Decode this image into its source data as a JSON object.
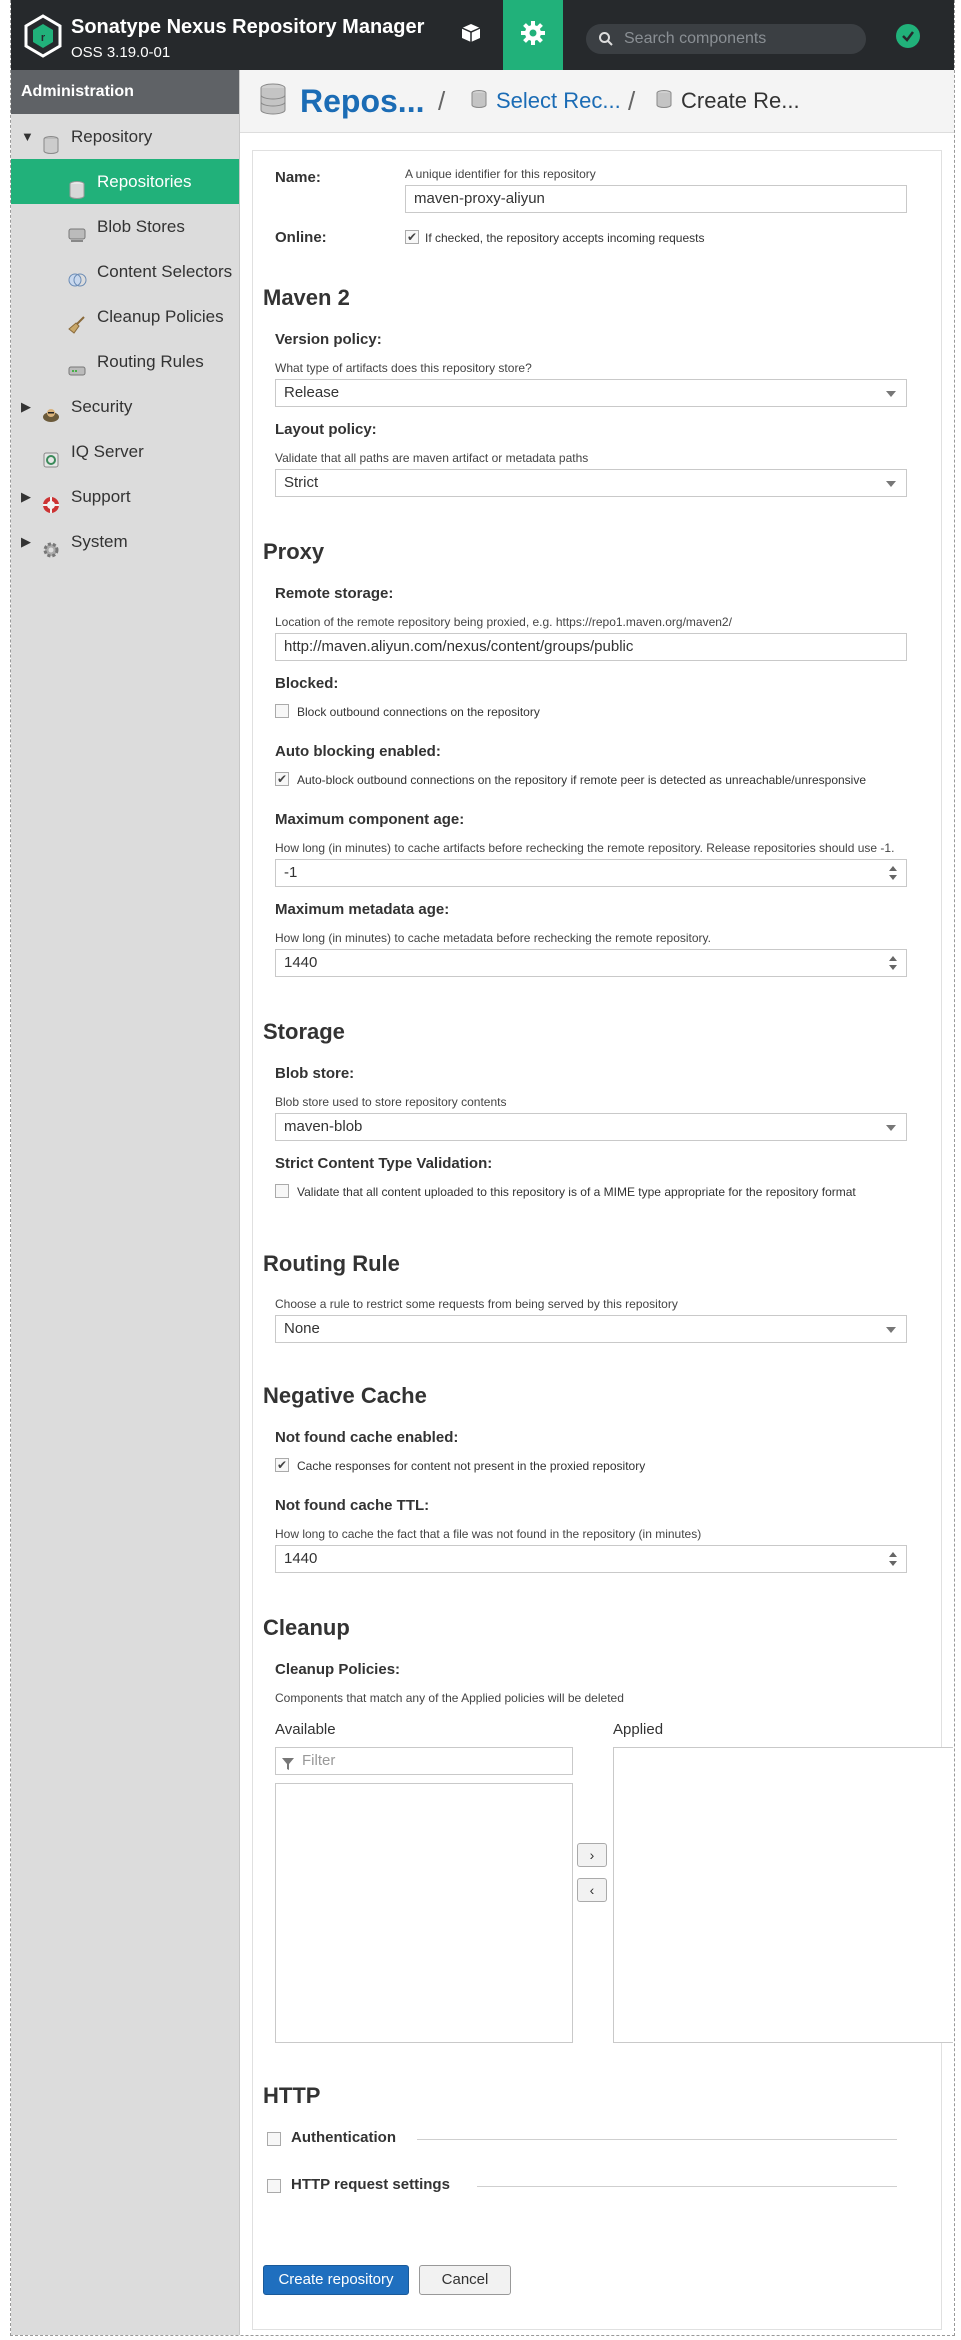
{
  "header": {
    "app_title": "Sonatype Nexus Repository Manager",
    "version": "OSS 3.19.0-01",
    "search_placeholder": "Search components",
    "icons": {
      "browse": "cube-icon",
      "admin": "gear-icon",
      "search": "search-icon",
      "status": "check-circle-icon"
    }
  },
  "sidebar": {
    "title": "Administration",
    "items": [
      {
        "label": "Repository",
        "icon": "database-icon",
        "expanded": true
      },
      {
        "label": "Repositories",
        "icon": "database-icon",
        "selected": true
      },
      {
        "label": "Blob Stores",
        "icon": "drive-icon"
      },
      {
        "label": "Content Selectors",
        "icon": "layers-icon"
      },
      {
        "label": "Cleanup Policies",
        "icon": "broom-icon"
      },
      {
        "label": "Routing Rules",
        "icon": "router-icon"
      },
      {
        "label": "Security",
        "icon": "security-icon",
        "expanded": false
      },
      {
        "label": "IQ Server",
        "icon": "iq-icon"
      },
      {
        "label": "Support",
        "icon": "support-icon",
        "expanded": false
      },
      {
        "label": "System",
        "icon": "system-gear-icon",
        "expanded": false
      }
    ]
  },
  "breadcrumb": {
    "root": "Repos...",
    "separator": "/",
    "middle": "Select Rec...",
    "last": "Create Re..."
  },
  "form": {
    "name": {
      "label": "Name:",
      "help": "A unique identifier for this repository",
      "value": "maven-proxy-aliyun"
    },
    "online": {
      "label": "Online:",
      "checkbox_label": "If checked, the repository accepts incoming requests",
      "checked": true
    },
    "maven": {
      "title": "Maven 2",
      "version_policy": {
        "label": "Version policy:",
        "help": "What type of artifacts does this repository store?",
        "value": "Release"
      },
      "layout_policy": {
        "label": "Layout policy:",
        "help": "Validate that all paths are maven artifact or metadata paths",
        "value": "Strict"
      }
    },
    "proxy": {
      "title": "Proxy",
      "remote_storage": {
        "label": "Remote storage:",
        "help": "Location of the remote repository being proxied, e.g. https://repo1.maven.org/maven2/",
        "value": "http://maven.aliyun.com/nexus/content/groups/public"
      },
      "blocked": {
        "label": "Blocked:",
        "checkbox_label": "Block outbound connections on the repository",
        "checked": false
      },
      "auto_blocking": {
        "label": "Auto blocking enabled:",
        "checkbox_label": "Auto-block outbound connections on the repository if remote peer is detected as unreachable/unresponsive",
        "checked": true
      },
      "max_component_age": {
        "label": "Maximum component age:",
        "help": "How long (in minutes) to cache artifacts before rechecking the remote repository. Release repositories should use -1.",
        "value": "-1"
      },
      "max_metadata_age": {
        "label": "Maximum metadata age:",
        "help": "How long (in minutes) to cache metadata before rechecking the remote repository.",
        "value": "1440"
      }
    },
    "storage": {
      "title": "Storage",
      "blob_store": {
        "label": "Blob store:",
        "help": "Blob store used to store repository contents",
        "value": "maven-blob"
      },
      "strict_content": {
        "label": "Strict Content Type Validation:",
        "checkbox_label": "Validate that all content uploaded to this repository is of a MIME type appropriate for the repository format",
        "checked": false
      }
    },
    "routing": {
      "title": "Routing Rule",
      "help": "Choose a rule to restrict some requests from being served by this repository",
      "value": "None"
    },
    "negative_cache": {
      "title": "Negative Cache",
      "enabled": {
        "label": "Not found cache enabled:",
        "checkbox_label": "Cache responses for content not present in the proxied repository",
        "checked": true
      },
      "ttl": {
        "label": "Not found cache TTL:",
        "help": "How long to cache the fact that a file was not found in the repository (in minutes)",
        "value": "1440"
      }
    },
    "cleanup": {
      "title": "Cleanup",
      "policies_label": "Cleanup Policies:",
      "help": "Components that match any of the Applied policies will be deleted",
      "available_label": "Available",
      "applied_label": "Applied",
      "filter_placeholder": "Filter",
      "move_right": "›",
      "move_left": "‹"
    },
    "http": {
      "title": "HTTP",
      "authentication": "Authentication",
      "request_settings": "HTTP request settings"
    },
    "buttons": {
      "create": "Create repository",
      "cancel": "Cancel"
    }
  },
  "colors": {
    "accent": "#21b17a",
    "header_bg": "#26292c",
    "link": "#1b6cb5",
    "primary_button": "#1f6fbf"
  }
}
